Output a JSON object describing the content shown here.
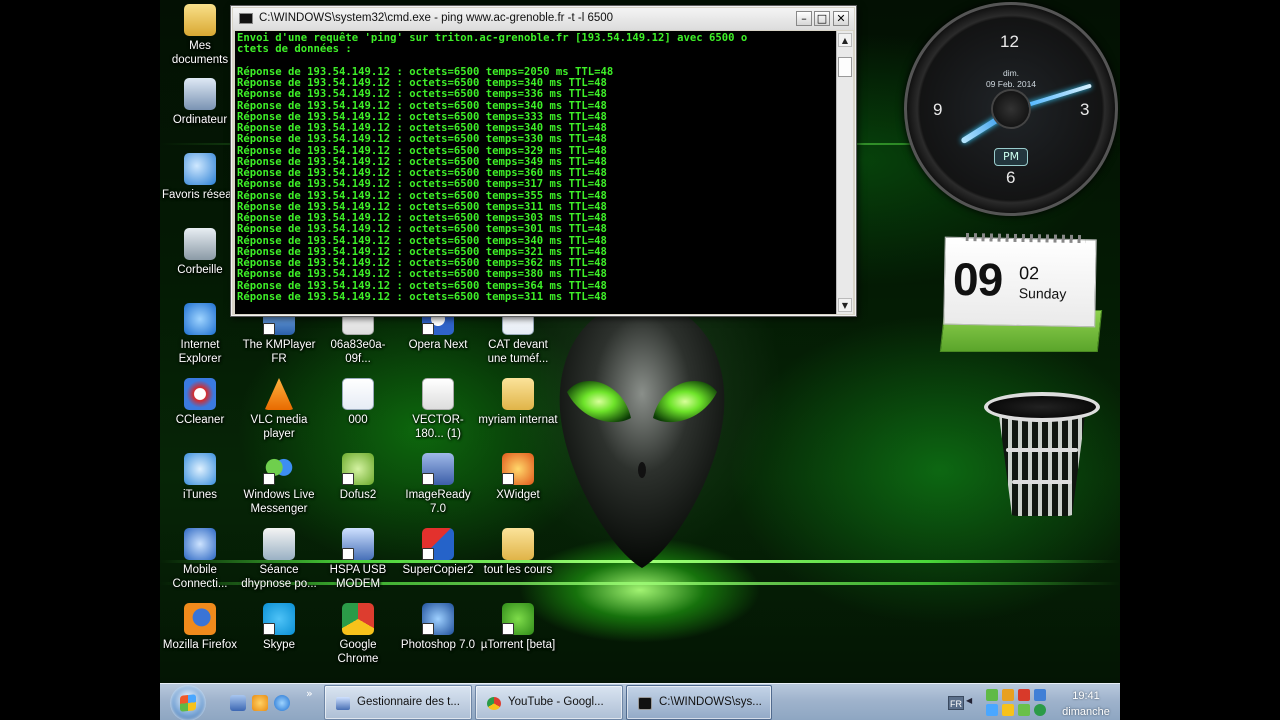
{
  "console_window": {
    "title": "C:\\WINDOWS\\system32\\cmd.exe - ping www.ac-grenoble.fr -t -l 6500",
    "min_label": "–",
    "max_label": "□",
    "close_label": "✕",
    "output": "Envoi d'une requête 'ping' sur triton.ac-grenoble.fr [193.54.149.12] avec 6500 o\nctets de données :\n\nRéponse de 193.54.149.12 : octets=6500 temps=2050 ms TTL=48\nRéponse de 193.54.149.12 : octets=6500 temps=340 ms TTL=48\nRéponse de 193.54.149.12 : octets=6500 temps=336 ms TTL=48\nRéponse de 193.54.149.12 : octets=6500 temps=340 ms TTL=48\nRéponse de 193.54.149.12 : octets=6500 temps=333 ms TTL=48\nRéponse de 193.54.149.12 : octets=6500 temps=340 ms TTL=48\nRéponse de 193.54.149.12 : octets=6500 temps=330 ms TTL=48\nRéponse de 193.54.149.12 : octets=6500 temps=329 ms TTL=48\nRéponse de 193.54.149.12 : octets=6500 temps=349 ms TTL=48\nRéponse de 193.54.149.12 : octets=6500 temps=360 ms TTL=48\nRéponse de 193.54.149.12 : octets=6500 temps=317 ms TTL=48\nRéponse de 193.54.149.12 : octets=6500 temps=355 ms TTL=48\nRéponse de 193.54.149.12 : octets=6500 temps=311 ms TTL=48\nRéponse de 193.54.149.12 : octets=6500 temps=303 ms TTL=48\nRéponse de 193.54.149.12 : octets=6500 temps=301 ms TTL=48\nRéponse de 193.54.149.12 : octets=6500 temps=340 ms TTL=48\nRéponse de 193.54.149.12 : octets=6500 temps=321 ms TTL=48\nRéponse de 193.54.149.12 : octets=6500 temps=362 ms TTL=48\nRéponse de 193.54.149.12 : octets=6500 temps=380 ms TTL=48\nRéponse de 193.54.149.12 : octets=6500 temps=364 ms TTL=48\nRéponse de 193.54.149.12 : octets=6500 temps=311 ms TTL=48",
    "text_color": "#3ef028"
  },
  "desktop_icons": {
    "mes_documents": "Mes documents",
    "ordinateur": "Ordinateur",
    "favoris_reseau": "Favoris réseau",
    "corbeille": "Corbeille",
    "internet_explorer": "Internet Explorer",
    "kmplayer": "The KMPlayer FR",
    "pdf_06a": "06a83e0a-09f...",
    "opera_next": "Opera Next",
    "cat_devant": "CAT devant une tuméf...",
    "ccleaner": "CCleaner",
    "vlc": "VLC media player",
    "doc_000": "000",
    "vector_pdf": "VECTOR-180... (1)",
    "myriam": "myriam internat",
    "itunes": "iTunes",
    "windows_live": "Windows Live Messenger",
    "dofus2": "Dofus2",
    "imageready": "ImageReady 7.0",
    "xwidget": "XWidget",
    "mobile_connect": "Mobile Connecti...",
    "seance": "Séance dhypnose po...",
    "hspa": "HSPA USB MODEM",
    "supercopier": "SuperCopier2",
    "tout_les_cours": "tout les cours",
    "firefox": "Mozilla Firefox",
    "skype": "Skype",
    "chrome": "Google Chrome",
    "photoshop": "Photoshop 7.0",
    "utorrent": "µTorrent [beta]"
  },
  "clock_gadget": {
    "n12": "12",
    "n3": "3",
    "n6": "6",
    "n9": "9",
    "day_abbr": "dim.",
    "date": "09 Feb. 2014",
    "ampm": "PM"
  },
  "calendar_gadget": {
    "day": "09",
    "month": "02",
    "weekday": "Sunday"
  },
  "taskbar": {
    "tasks": [
      {
        "label": "Gestionnaire des t..."
      },
      {
        "label": "YouTube - Googl..."
      },
      {
        "label": "C:\\WINDOWS\\sys..."
      }
    ],
    "quicklaunch_more": "»",
    "language": "FR",
    "time": "19:41",
    "day": "dimanche"
  },
  "colors": {
    "accent_green": "#3ef028",
    "taskbar": "#9fb3cc"
  }
}
